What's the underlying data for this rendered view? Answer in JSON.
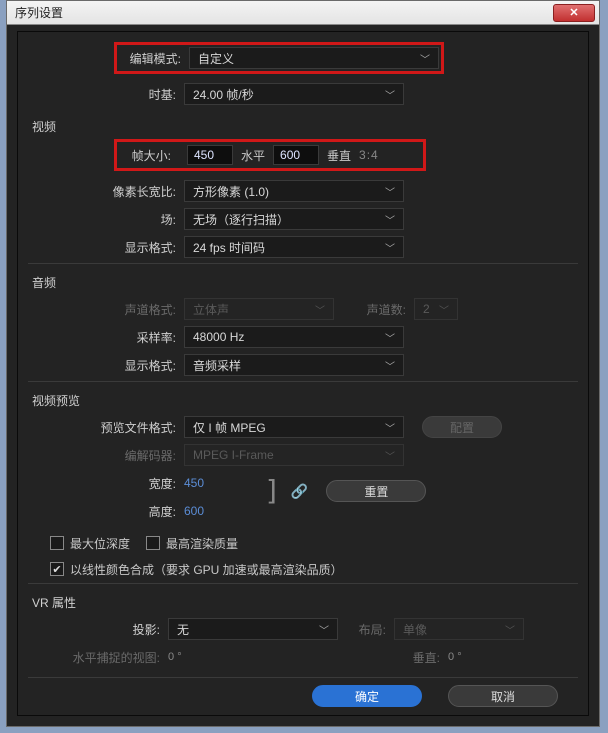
{
  "window": {
    "title": "序列设置"
  },
  "editMode": {
    "label": "编辑模式:",
    "value": "自定义"
  },
  "timebase": {
    "label": "时基:",
    "value": "24.00 帧/秒"
  },
  "video": {
    "section": "视频",
    "frameSize": {
      "label": "帧大小:",
      "w": "450",
      "hLabel": "水平",
      "h": "600",
      "vLabel": "垂直",
      "ratio": "3:4"
    },
    "pixelAspect": {
      "label": "像素长宽比:",
      "value": "方形像素 (1.0)"
    },
    "fields": {
      "label": "场:",
      "value": "无场（逐行扫描）"
    },
    "displayFormat": {
      "label": "显示格式:",
      "value": "24 fps 时间码"
    }
  },
  "audio": {
    "section": "音频",
    "channelFormat": {
      "label": "声道格式:",
      "value": "立体声"
    },
    "channelCount": {
      "label": "声道数:",
      "value": "2"
    },
    "sampleRate": {
      "label": "采样率:",
      "value": "48000 Hz"
    },
    "displayFormat": {
      "label": "显示格式:",
      "value": "音频采样"
    }
  },
  "preview": {
    "section": "视频预览",
    "fileFormat": {
      "label": "预览文件格式:",
      "value": "仅 I 帧 MPEG"
    },
    "configure": "配置",
    "codec": {
      "label": "编解码器:",
      "value": "MPEG I-Frame"
    },
    "width": {
      "label": "宽度:",
      "value": "450"
    },
    "height": {
      "label": "高度:",
      "value": "600"
    },
    "reset": "重置",
    "maxBitDepth": "最大位深度",
    "maxRenderQuality": "最高渲染质量",
    "linearComposite": "以线性颜色合成（要求 GPU 加速或最高渲染品质）"
  },
  "vr": {
    "section": "VR 属性",
    "projection": {
      "label": "投影:",
      "value": "无"
    },
    "layout": {
      "label": "布局:",
      "value": "单像"
    },
    "hCapture": {
      "label": "水平捕捉的视图:",
      "value": "0",
      "deg": "°"
    },
    "vCapture": {
      "label": "垂直:",
      "value": "0",
      "deg": "°"
    }
  },
  "footer": {
    "ok": "确定",
    "cancel": "取消"
  }
}
